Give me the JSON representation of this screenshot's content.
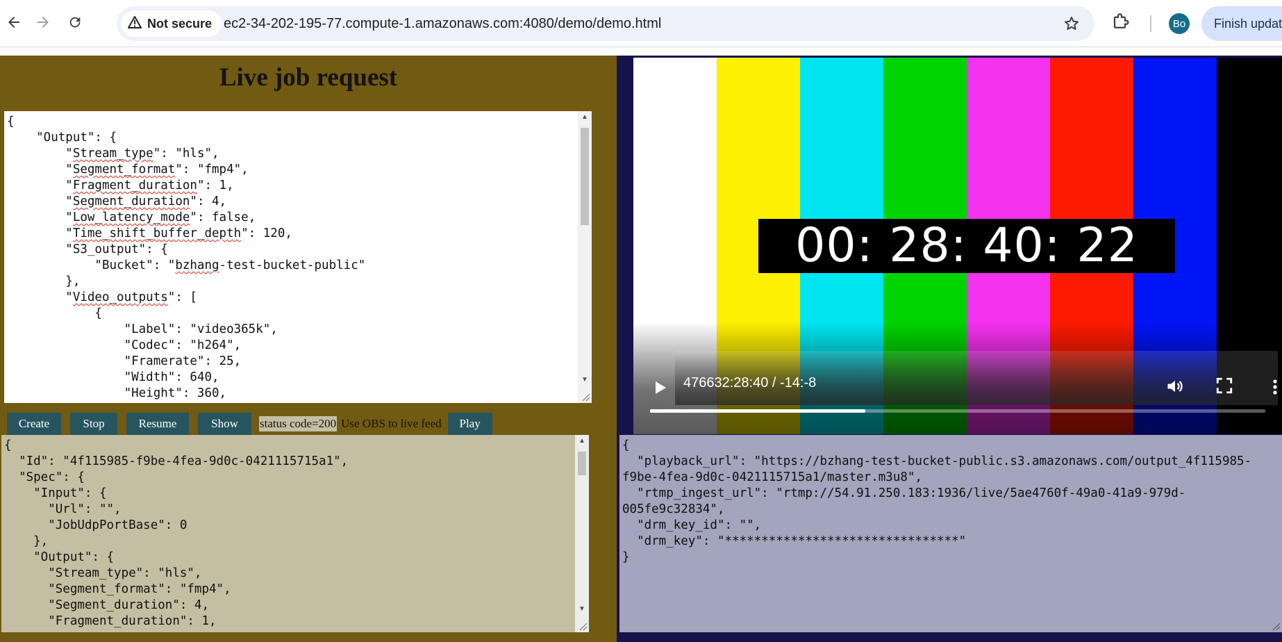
{
  "browser": {
    "security_label": "Not secure",
    "url": "ec2-34-202-195-77.compute-1.amazonaws.com:4080/demo/demo.html",
    "profile_initials": "Bo",
    "update_label": "Finish updat"
  },
  "page": {
    "title": "Live job request",
    "request_json": [
      [
        {
          "t": "{"
        }
      ],
      [
        {
          "t": "    \"Output\": {"
        }
      ],
      [
        {
          "t": "        \""
        },
        {
          "t": "Stream_type",
          "sq": true
        },
        {
          "t": "\": \"hls\","
        }
      ],
      [
        {
          "t": "        \""
        },
        {
          "t": "Segment_format",
          "sq": true
        },
        {
          "t": "\": \"fmp4\","
        }
      ],
      [
        {
          "t": "        \""
        },
        {
          "t": "Fragment_duration",
          "sq": true
        },
        {
          "t": "\": 1,"
        }
      ],
      [
        {
          "t": "        \""
        },
        {
          "t": "Segment_duration",
          "sq": true
        },
        {
          "t": "\": 4,"
        }
      ],
      [
        {
          "t": "        \""
        },
        {
          "t": "Low_latency_mode",
          "sq": true
        },
        {
          "t": "\": false,"
        }
      ],
      [
        {
          "t": "        \""
        },
        {
          "t": "Time_shift_buffer_depth",
          "sq": true
        },
        {
          "t": "\": 120,"
        }
      ],
      [
        {
          "t": "        \"S3_output\": {"
        }
      ],
      [
        {
          "t": "            \"Bucket\": \""
        },
        {
          "t": "bzhang",
          "sq": true
        },
        {
          "t": "-test-bucket-public\""
        }
      ],
      [
        {
          "t": "        },"
        }
      ],
      [
        {
          "t": "        \""
        },
        {
          "t": "Video_outputs",
          "sq": true
        },
        {
          "t": "\": ["
        }
      ],
      [
        {
          "t": "            {"
        }
      ],
      [
        {
          "t": "                \"Label\": \"video365k\","
        }
      ],
      [
        {
          "t": "                \"Codec\": \"h264\","
        }
      ],
      [
        {
          "t": "                \"Framerate\": 25,"
        }
      ],
      [
        {
          "t": "                \"Width\": 640,"
        }
      ],
      [
        {
          "t": "                \"Height\": 360,"
        }
      ]
    ],
    "buttons": {
      "create": "Create",
      "stop": "Stop",
      "resume": "Resume",
      "show": "Show",
      "play": "Play"
    },
    "status_code": "status code=200",
    "obs_hint": "Use OBS to live feed",
    "job_json": [
      "{",
      "  \"Id\": \"4f115985-f9be-4fea-9d0c-0421115715a1\",",
      "  \"Spec\": {",
      "    \"Input\": {",
      "      \"Url\": \"\",",
      "      \"JobUdpPortBase\": 0",
      "    },",
      "    \"Output\": {",
      "      \"Stream_type\": \"hls\",",
      "      \"Segment_format\": \"fmp4\",",
      "      \"Segment_duration\": 4,",
      "      \"Fragment_duration\": 1,"
    ],
    "playback_json": [
      "{",
      "  \"playback_url\": \"https://bzhang-test-bucket-public.s3.amazonaws.com/output_4f115985-",
      "f9be-4fea-9d0c-0421115715a1/master.m3u8\",",
      "  \"rtmp_ingest_url\": \"rtmp://54.91.250.183:1936/live/5ae4760f-49a0-41a9-979d-",
      "005fe9c32834\",",
      "  \"drm_key_id\": \"\",",
      "  \"drm_key\": \"********************************\"",
      "}"
    ]
  },
  "video": {
    "timecode": "00: 28: 40: 22",
    "time_display": "476632:28:40 / -14:-8",
    "progress_fraction": 0.35,
    "bar_colors": [
      "#ffffff",
      "#fdf000",
      "#00e6f0",
      "#00d400",
      "#f531f0",
      "#fc1a00",
      "#0015f5",
      "#000000"
    ]
  },
  "colors": {
    "left_panel": "#715a12",
    "right_panel": "#16124a",
    "button": "#27555f",
    "job_box": "#c4bfa3",
    "playback_box": "#a3a4bd"
  }
}
